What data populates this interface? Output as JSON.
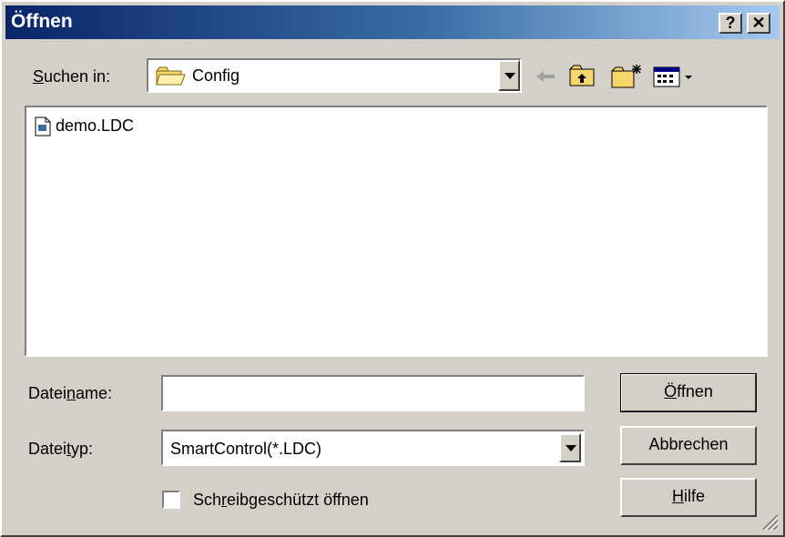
{
  "window": {
    "title": "Öffnen",
    "help_label": "?",
    "close_label": "✕"
  },
  "look_in": {
    "label": "Suchen in:",
    "accesskey": "S",
    "label_rest": "uchen in:",
    "value": "Config",
    "icons": [
      "folder-icon",
      "back-arrow-icon",
      "up-folder-icon",
      "new-folder-icon",
      "view-menu-icon"
    ]
  },
  "file_list": {
    "items": [
      {
        "name": "demo.LDC",
        "icon": "file-icon"
      }
    ]
  },
  "filename": {
    "label_pre": "Datei",
    "label_accesskey": "n",
    "label_post": "ame:",
    "value": ""
  },
  "filetype": {
    "label_pre": "Datei",
    "label_accesskey": "t",
    "label_post": "yp:",
    "value": "SmartControl(*.LDC)"
  },
  "readonly": {
    "label_pre": "Sch",
    "label_accesskey": "r",
    "label_post": "eibgeschützt öffnen",
    "checked": false
  },
  "buttons": {
    "open": {
      "pre": "",
      "accesskey": "Ö",
      "post": "ffnen"
    },
    "cancel": {
      "label": "Abbrechen"
    },
    "help": {
      "pre": "",
      "accesskey": "H",
      "post": "ilfe"
    }
  },
  "colors": {
    "face": "#d4d0c8",
    "title_start": "#0a246a",
    "title_end": "#a6caf0",
    "window": "#ffffff"
  }
}
